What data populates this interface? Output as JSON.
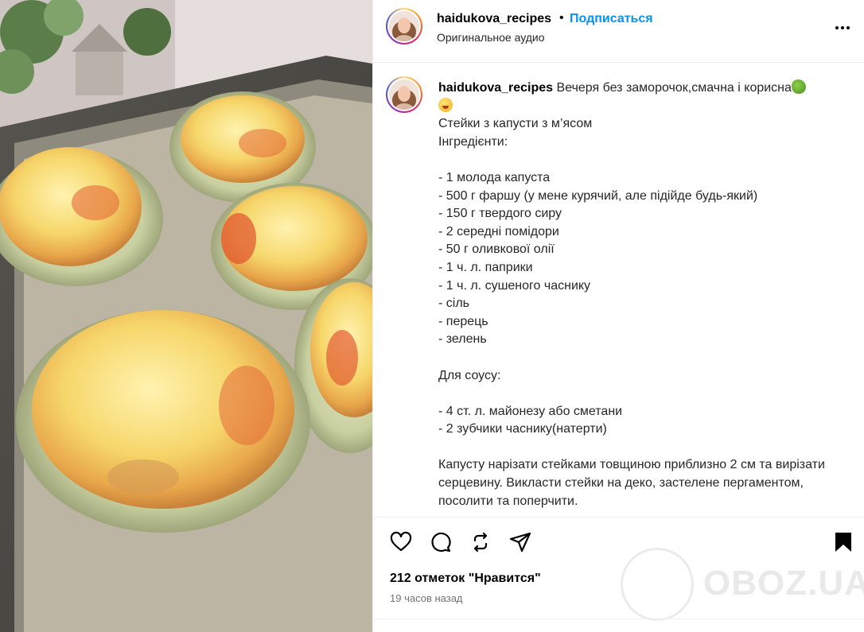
{
  "post": {
    "username": "haidukova_recipes",
    "separator": "•",
    "follow_label": "Подписаться",
    "audio_label": "Оригинальное аудио",
    "more_icon": "more-horizontal-icon"
  },
  "caption": {
    "username": "haidukova_recipes",
    "intro": "Вечеря без заморочок,смачна і корисна",
    "body": "Стейки з капусти з м’ясом \nІнгредієнти:\n\n- 1 молода капуста\n- 500 г фаршу (у мене курячий, але підійде будь-який)\n- 150 г твердого сиру\n- 2 середні помідори\n- 50 г оливкової олії\n- 1 ч. л. паприки\n- 1 ч. л. сушеного часнику\n- сіль\n- перець\n- зелень\n\nДля соусу:\n\n- 4 ст. л. майонезу або сметани\n- 2 зубчики часнику(натерти)\n\nКапусту нарізати стейками товщиною приблизно 2 см та вирізати серцевину. Викласти стейки на деко, застелене пергаментом, посолити та поперчити."
  },
  "actions": {
    "like_icon": "heart-icon",
    "comment_icon": "comment-icon",
    "repost_icon": "repost-icon",
    "share_icon": "send-icon",
    "save_icon": "bookmark-icon"
  },
  "stats": {
    "likes": "212 отметок \"Нравится\"",
    "time": "19 часов назад"
  },
  "watermark": {
    "text": "OBOZ.UA"
  },
  "colors": {
    "link": "#0095f6",
    "text": "#262626",
    "muted": "#737373",
    "divider": "#efefef"
  }
}
